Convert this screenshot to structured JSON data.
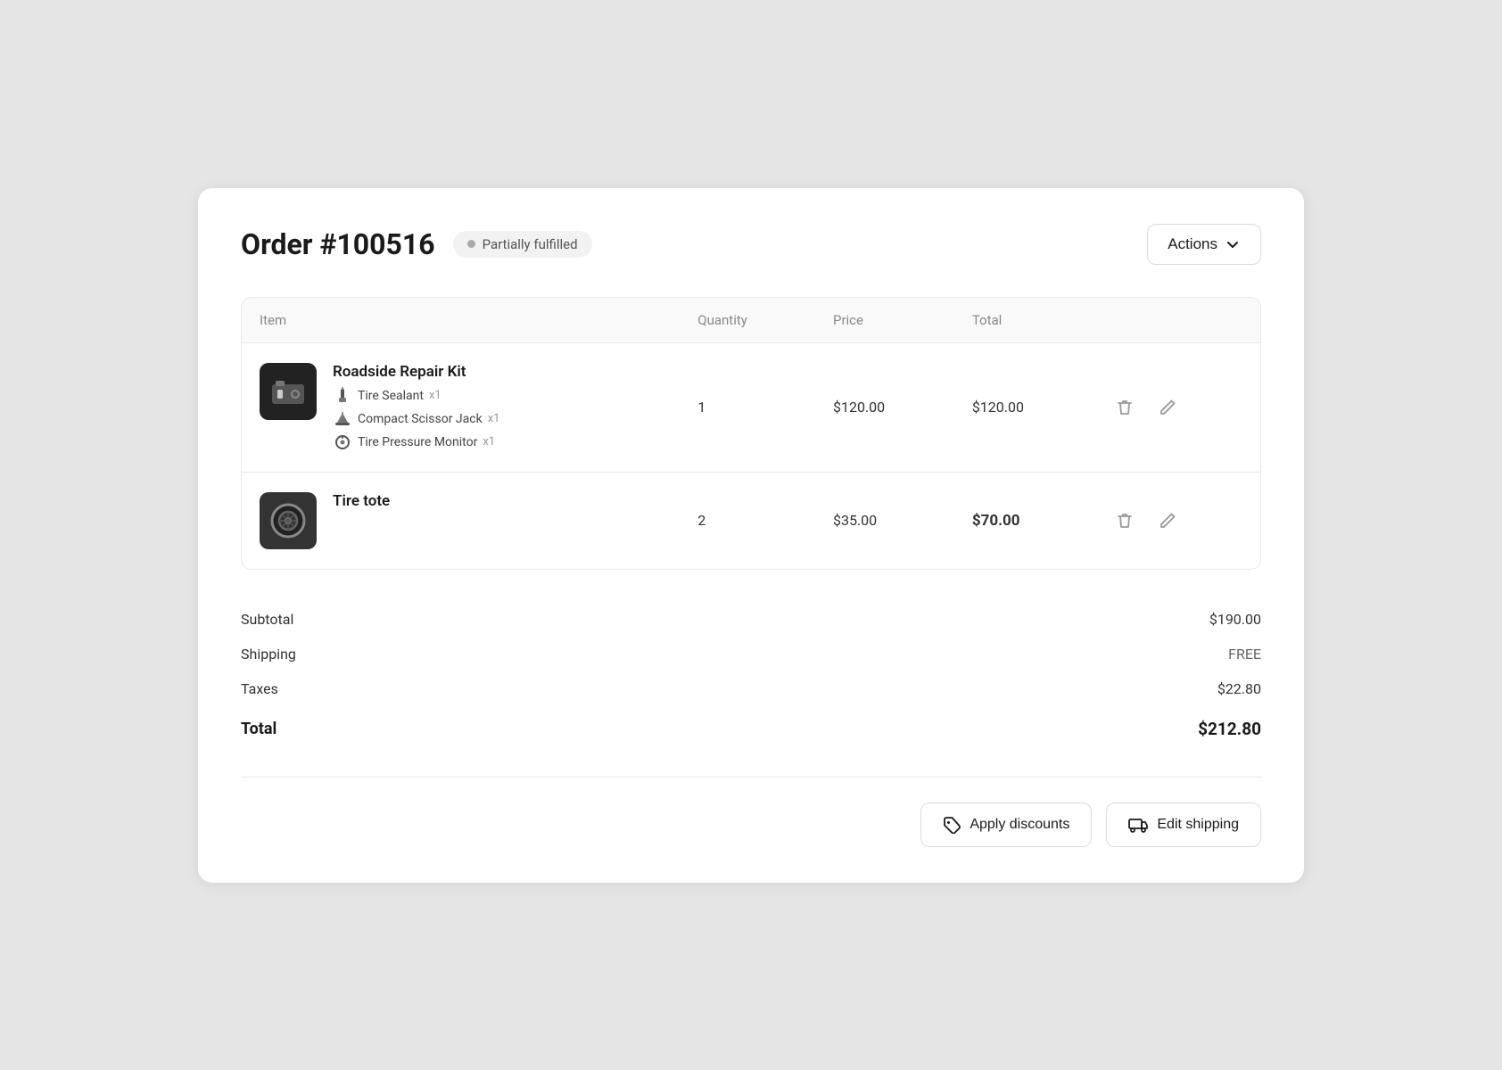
{
  "header": {
    "order_number": "Order #100516",
    "status_label": "Partially fulfilled",
    "actions_label": "Actions"
  },
  "table": {
    "columns": {
      "item": "Item",
      "quantity": "Quantity",
      "price": "Price",
      "total": "Total"
    },
    "rows": [
      {
        "id": "row-1",
        "name": "Roadside Repair Kit",
        "sub_items": [
          {
            "name": "Tire Sealant",
            "qty": "x1"
          },
          {
            "name": "Compact Scissor Jack",
            "qty": "x1"
          },
          {
            "name": "Tire Pressure Monitor",
            "qty": "x1"
          }
        ],
        "quantity": "1",
        "price": "$120.00",
        "total": "$120.00",
        "total_bold": false
      },
      {
        "id": "row-2",
        "name": "Tire tote",
        "sub_items": [],
        "quantity": "2",
        "price": "$35.00",
        "total": "$70.00",
        "total_bold": true
      }
    ]
  },
  "summary": {
    "subtotal_label": "Subtotal",
    "subtotal_value": "$190.00",
    "shipping_label": "Shipping",
    "shipping_value": "FREE",
    "taxes_label": "Taxes",
    "taxes_value": "$22.80",
    "total_label": "Total",
    "total_value": "$212.80"
  },
  "footer": {
    "apply_discounts_label": "Apply discounts",
    "edit_shipping_label": "Edit shipping"
  }
}
